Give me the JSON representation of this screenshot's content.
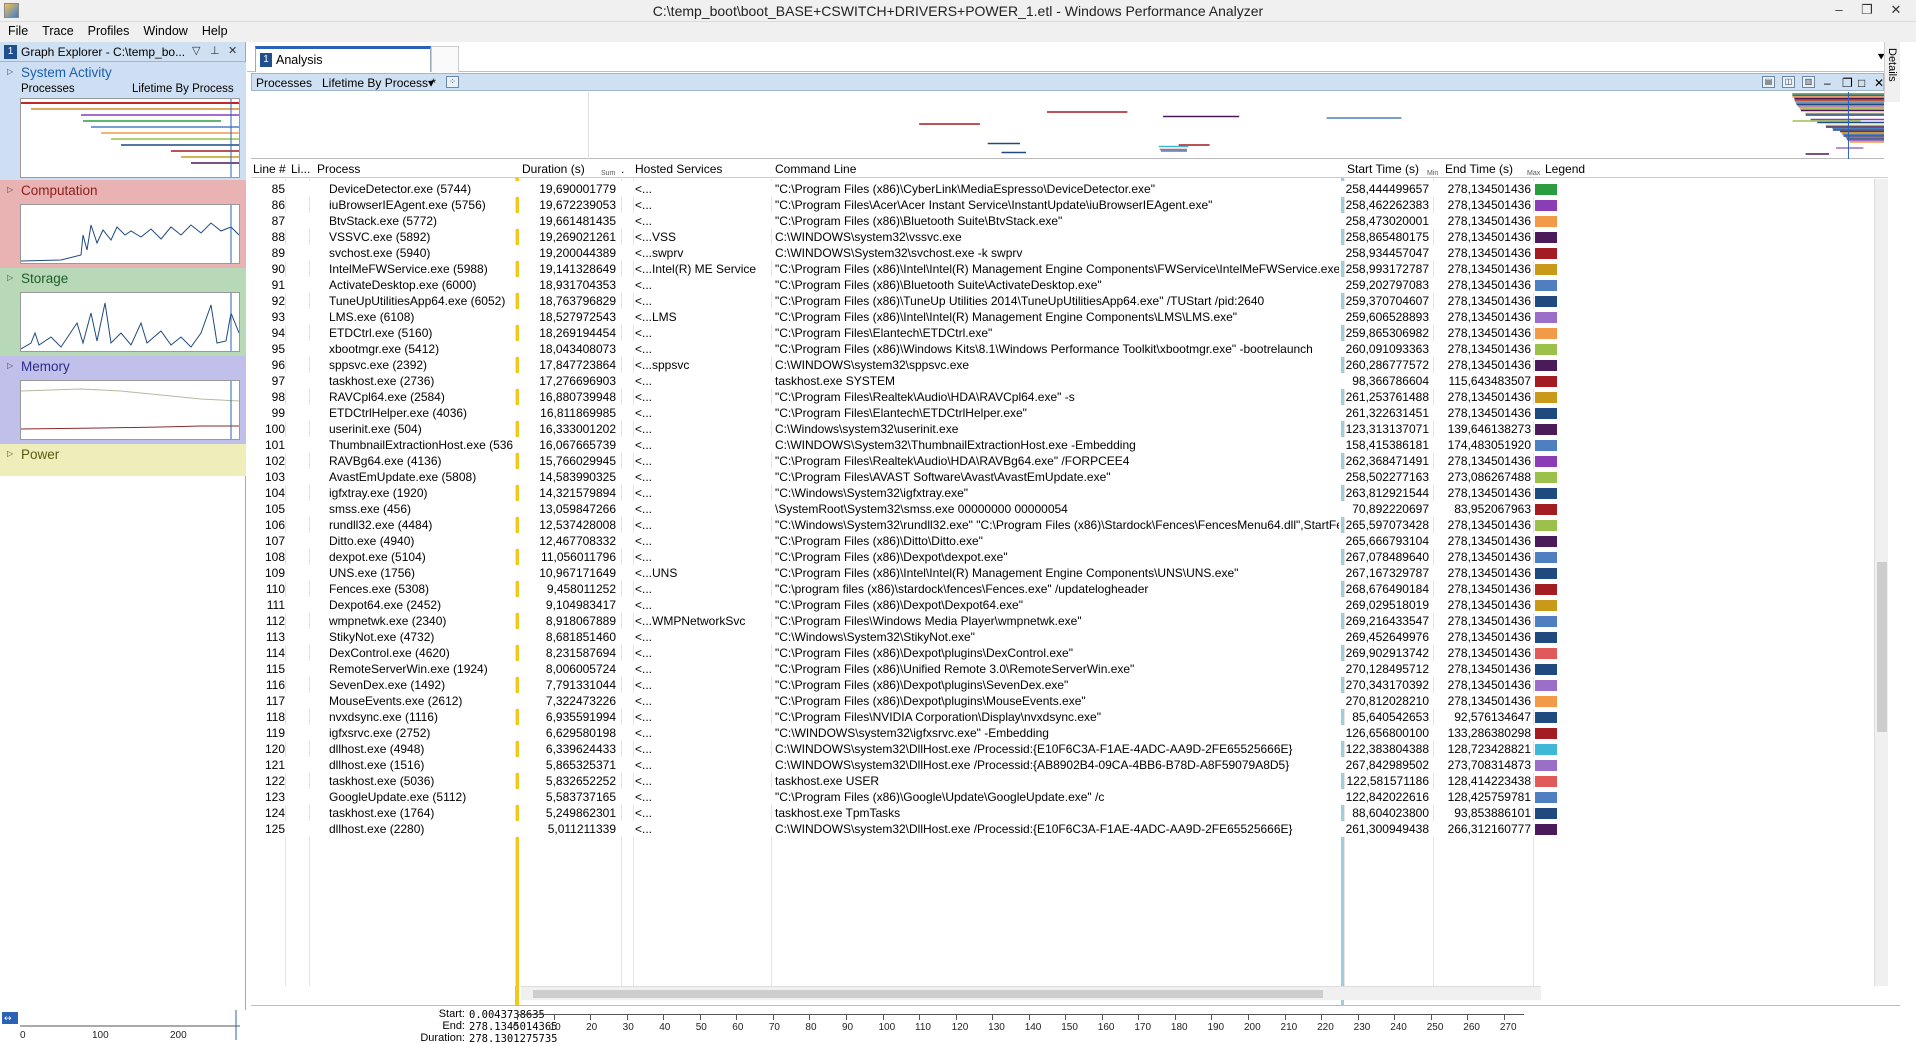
{
  "window": {
    "title": "C:\\temp_boot\\boot_BASE+CSWITCH+DRIVERS+POWER_1.etl - Windows Performance Analyzer",
    "minimize": "–",
    "restore": "❐",
    "close": "✕"
  },
  "menu": [
    "File",
    "Trace",
    "Profiles",
    "Window",
    "Help"
  ],
  "graph_explorer": {
    "number": "1",
    "title": "Graph Explorer - C:\\temp_bo...",
    "categories": [
      {
        "name": "System Activity",
        "sub_left": "Processes",
        "sub_right": "Lifetime By Process"
      },
      {
        "name": "Computation"
      },
      {
        "name": "Storage"
      },
      {
        "name": "Memory"
      },
      {
        "name": "Power"
      }
    ],
    "mini_axis": [
      "0",
      "100",
      "200"
    ]
  },
  "analysis": {
    "tab_number": "1",
    "tab_label": "Analysis",
    "details_label": "Details",
    "view_label": "Processes",
    "preset_label": "Lifetime By Process *",
    "columns": {
      "line": "Line #",
      "li": "Li...",
      "process": "Process",
      "duration": "Duration (s)",
      "duration_sub": "Sum",
      "dot": ".",
      "hosted": "Hosted Services",
      "cmd": "Command Line",
      "start": "Start Time (s)",
      "start_sub": "Min",
      "end": "End Time (s)",
      "end_sub": "Max",
      "legend": "Legend"
    }
  },
  "rows": [
    {
      "n": "85",
      "p": "DeviceDetector.exe (5744)",
      "d": "19,690001779",
      "h": "<...",
      "c": "\"C:\\Program Files (x86)\\CyberLink\\MediaEspresso\\DeviceDetector.exe\"",
      "s": "258,444499657",
      "e": "278,134501436",
      "col": "#2a9d3f"
    },
    {
      "n": "86",
      "p": "iuBrowserIEAgent.exe (5756)",
      "d": "19,672239053",
      "h": "<...",
      "c": "\"C:\\Program Files\\Acer\\Acer Instant Service\\InstantUpdate\\iuBrowserIEAgent.exe\"",
      "s": "258,462262383",
      "e": "278,134501436",
      "col": "#8a3db5"
    },
    {
      "n": "87",
      "p": "BtvStack.exe (5772)",
      "d": "19,661481435",
      "h": "<...",
      "c": "\"C:\\Program Files (x86)\\Bluetooth Suite\\BtvStack.exe\"",
      "s": "258,473020001",
      "e": "278,134501436",
      "col": "#f29a47"
    },
    {
      "n": "88",
      "p": "VSSVC.exe (5892)",
      "d": "19,269021261",
      "h": "<...VSS",
      "c": "C:\\WINDOWS\\system32\\vssvc.exe",
      "s": "258,865480175",
      "e": "278,134501436",
      "col": "#4a1a5a"
    },
    {
      "n": "89",
      "p": "svchost.exe (5940)",
      "d": "19,200044389",
      "h": "<...swprv",
      "c": "C:\\WINDOWS\\System32\\svchost.exe -k swprv",
      "s": "258,934457047",
      "e": "278,134501436",
      "col": "#a31c22"
    },
    {
      "n": "90",
      "p": "IntelMeFWService.exe (5988)",
      "d": "19,141328649",
      "h": "<...Intel(R) ME Service",
      "c": "\"C:\\Program Files (x86)\\Intel\\Intel(R) Management Engine Components\\FWService\\IntelMeFWService.exe\"",
      "s": "258,993172787",
      "e": "278,134501436",
      "col": "#c99a1a"
    },
    {
      "n": "91",
      "p": "ActivateDesktop.exe (6000)",
      "d": "18,931704353",
      "h": "<...",
      "c": "\"C:\\Program Files (x86)\\Bluetooth Suite\\ActivateDesktop.exe\"",
      "s": "259,202797083",
      "e": "278,134501436",
      "col": "#4f7fc0"
    },
    {
      "n": "92",
      "p": "TuneUpUtilitiesApp64.exe (6052)",
      "d": "18,763796829",
      "h": "<...",
      "c": "\"C:\\Program Files (x86)\\TuneUp Utilities 2014\\TuneUpUtilitiesApp64.exe\" /TUStart /pid:2640",
      "s": "259,370704607",
      "e": "278,134501436",
      "col": "#1f4a80"
    },
    {
      "n": "93",
      "p": "LMS.exe (6108)",
      "d": "18,527972543",
      "h": "<...LMS",
      "c": "\"C:\\Program Files (x86)\\Intel\\Intel(R) Management Engine Components\\LMS\\LMS.exe\"",
      "s": "259,606528893",
      "e": "278,134501436",
      "col": "#9b6fc8"
    },
    {
      "n": "94",
      "p": "ETDCtrl.exe (5160)",
      "d": "18,269194454",
      "h": "<...",
      "c": "\"C:\\Program Files\\Elantech\\ETDCtrl.exe\"",
      "s": "259,865306982",
      "e": "278,134501436",
      "col": "#f29a47"
    },
    {
      "n": "95",
      "p": "xbootmgr.exe (5412)",
      "d": "18,043408073",
      "h": "<...",
      "c": "\"C:\\Program Files (x86)\\Windows Kits\\8.1\\Windows Performance Toolkit\\xbootmgr.exe\" -bootrelaunch",
      "s": "260,091093363",
      "e": "278,134501436",
      "col": "#9bc14a"
    },
    {
      "n": "96",
      "p": "sppsvc.exe (2392)",
      "d": "17,847723864",
      "h": "<...sppsvc",
      "c": "C:\\WINDOWS\\system32\\sppsvc.exe",
      "s": "260,286777572",
      "e": "278,134501436",
      "col": "#4a1a5a"
    },
    {
      "n": "97",
      "p": "taskhost.exe (2736)",
      "d": "17,276696903",
      "h": "<...",
      "c": "taskhost.exe SYSTEM",
      "s": "98,366786604",
      "e": "115,643483507",
      "col": "#a31c22"
    },
    {
      "n": "98",
      "p": "RAVCpl64.exe (2584)",
      "d": "16,880739948",
      "h": "<...",
      "c": "\"C:\\Program Files\\Realtek\\Audio\\HDA\\RAVCpl64.exe\" -s",
      "s": "261,253761488",
      "e": "278,134501436",
      "col": "#c99a1a"
    },
    {
      "n": "99",
      "p": "ETDCtrlHelper.exe (4036)",
      "d": "16,811869985",
      "h": "<...",
      "c": "\"C:\\Program Files\\Elantech\\ETDCtrlHelper.exe\"",
      "s": "261,322631451",
      "e": "278,134501436",
      "col": "#1f4a80"
    },
    {
      "n": "100",
      "p": "userinit.exe (504)",
      "d": "16,333001202",
      "h": "<...",
      "c": "C:\\Windows\\system32\\userinit.exe",
      "s": "123,313137071",
      "e": "139,646138273",
      "col": "#4a1a5a"
    },
    {
      "n": "101",
      "p": "ThumbnailExtractionHost.exe (5368)",
      "d": "16,067665739",
      "h": "<...",
      "c": "C:\\WINDOWS\\System32\\ThumbnailExtractionHost.exe -Embedding",
      "s": "158,415386181",
      "e": "174,483051920",
      "col": "#4f7fc0"
    },
    {
      "n": "102",
      "p": "RAVBg64.exe (4136)",
      "d": "15,766029945",
      "h": "<...",
      "c": "\"C:\\Program Files\\Realtek\\Audio\\HDA\\RAVBg64.exe\" /FORPCEE4",
      "s": "262,368471491",
      "e": "278,134501436",
      "col": "#8a3db5"
    },
    {
      "n": "103",
      "p": "AvastEmUpdate.exe (5808)",
      "d": "14,583990325",
      "h": "<...",
      "c": "\"C:\\Program Files\\AVAST Software\\Avast\\AvastEmUpdate.exe\"",
      "s": "258,502277163",
      "e": "273,086267488",
      "col": "#9bc14a"
    },
    {
      "n": "104",
      "p": "igfxtray.exe (1920)",
      "d": "14,321579894",
      "h": "<...",
      "c": "\"C:\\Windows\\System32\\igfxtray.exe\"",
      "s": "263,812921544",
      "e": "278,134501436",
      "col": "#1f4a80"
    },
    {
      "n": "105",
      "p": "smss.exe (456)",
      "d": "13,059847266",
      "h": "<...",
      "c": "\\SystemRoot\\System32\\smss.exe 00000000 00000054",
      "s": "70,892220697",
      "e": "83,952067963",
      "col": "#a31c22"
    },
    {
      "n": "106",
      "p": "rundll32.exe (4484)",
      "d": "12,537428008",
      "h": "<...",
      "c": "\"C:\\Windows\\System32\\rundll32.exe\" \"C:\\Program Files (x86)\\Stardock\\Fences\\FencesMenu64.dll\",StartFences",
      "s": "265,597073428",
      "e": "278,134501436",
      "col": "#9bc14a"
    },
    {
      "n": "107",
      "p": "Ditto.exe (4940)",
      "d": "12,467708332",
      "h": "<...",
      "c": "\"C:\\Program Files (x86)\\Ditto\\Ditto.exe\"",
      "s": "265,666793104",
      "e": "278,134501436",
      "col": "#4a1a5a"
    },
    {
      "n": "108",
      "p": "dexpot.exe (5104)",
      "d": "11,056011796",
      "h": "<...",
      "c": "\"C:\\Program Files (x86)\\Dexpot\\dexpot.exe\"",
      "s": "267,078489640",
      "e": "278,134501436",
      "col": "#4f7fc0"
    },
    {
      "n": "109",
      "p": "UNS.exe (1756)",
      "d": "10,967171649",
      "h": "<...UNS",
      "c": "\"C:\\Program Files (x86)\\Intel\\Intel(R) Management Engine Components\\UNS\\UNS.exe\"",
      "s": "267,167329787",
      "e": "278,134501436",
      "col": "#1f4a80"
    },
    {
      "n": "110",
      "p": "Fences.exe (5308)",
      "d": "9,458011252",
      "h": "<...",
      "c": "\"C:\\program files (x86)\\stardock\\fences\\Fences.exe\" /updatelogheader",
      "s": "268,676490184",
      "e": "278,134501436",
      "col": "#a31c22"
    },
    {
      "n": "111",
      "p": "Dexpot64.exe (2452)",
      "d": "9,104983417",
      "h": "<...",
      "c": "\"C:\\Program Files (x86)\\Dexpot\\Dexpot64.exe\"",
      "s": "269,029518019",
      "e": "278,134501436",
      "col": "#c99a1a"
    },
    {
      "n": "112",
      "p": "wmpnetwk.exe (2340)",
      "d": "8,918067889",
      "h": "<...WMPNetworkSvc",
      "c": "\"C:\\Program Files\\Windows Media Player\\wmpnetwk.exe\"",
      "s": "269,216433547",
      "e": "278,134501436",
      "col": "#4f7fc0"
    },
    {
      "n": "113",
      "p": "StikyNot.exe (4732)",
      "d": "8,681851460",
      "h": "<...",
      "c": "\"C:\\Windows\\System32\\StikyNot.exe\"",
      "s": "269,452649976",
      "e": "278,134501436",
      "col": "#1f4a80"
    },
    {
      "n": "114",
      "p": "DexControl.exe (4620)",
      "d": "8,231587694",
      "h": "<...",
      "c": "\"C:\\Program Files (x86)\\Dexpot\\plugins\\DexControl.exe\"",
      "s": "269,902913742",
      "e": "278,134501436",
      "col": "#e05a5a"
    },
    {
      "n": "115",
      "p": "RemoteServerWin.exe (1924)",
      "d": "8,006005724",
      "h": "<...",
      "c": "\"C:\\Program Files (x86)\\Unified Remote 3.0\\RemoteServerWin.exe\"",
      "s": "270,128495712",
      "e": "278,134501436",
      "col": "#1f4a80"
    },
    {
      "n": "116",
      "p": "SevenDex.exe (1492)",
      "d": "7,791331044",
      "h": "<...",
      "c": "\"C:\\Program Files (x86)\\Dexpot\\plugins\\SevenDex.exe\"",
      "s": "270,343170392",
      "e": "278,134501436",
      "col": "#9b6fc8"
    },
    {
      "n": "117",
      "p": "MouseEvents.exe (2612)",
      "d": "7,322473226",
      "h": "<...",
      "c": "\"C:\\Program Files (x86)\\Dexpot\\plugins\\MouseEvents.exe\"",
      "s": "270,812028210",
      "e": "278,134501436",
      "col": "#f29a47"
    },
    {
      "n": "118",
      "p": "nvxdsync.exe (1116)",
      "d": "6,935591994",
      "h": "<...",
      "c": "\"C:\\Program Files\\NVIDIA Corporation\\Display\\nvxdsync.exe\"",
      "s": "85,640542653",
      "e": "92,576134647",
      "col": "#1f4a80"
    },
    {
      "n": "119",
      "p": "igfxsrvc.exe (2752)",
      "d": "6,629580198",
      "h": "<...",
      "c": "\"C:\\WINDOWS\\system32\\igfxsrvc.exe\" -Embedding",
      "s": "126,656800100",
      "e": "133,286380298",
      "col": "#a31c22"
    },
    {
      "n": "120",
      "p": "dllhost.exe (4948)",
      "d": "6,339624433",
      "h": "<...",
      "c": "C:\\WINDOWS\\system32\\DllHost.exe /Processid:{E10F6C3A-F1AE-4ADC-AA9D-2FE65525666E}",
      "s": "122,383804388",
      "e": "128,723428821",
      "col": "#3fb8d8"
    },
    {
      "n": "121",
      "p": "dllhost.exe (1516)",
      "d": "5,865325371",
      "h": "<...",
      "c": "C:\\WINDOWS\\system32\\DllHost.exe /Processid:{AB8902B4-09CA-4BB6-B78D-A8F59079A8D5}",
      "s": "267,842989502",
      "e": "273,708314873",
      "col": "#9b6fc8"
    },
    {
      "n": "122",
      "p": "taskhost.exe (5036)",
      "d": "5,832652252",
      "h": "<...",
      "c": "taskhost.exe USER",
      "s": "122,581571186",
      "e": "128,414223438",
      "col": "#e05a5a"
    },
    {
      "n": "123",
      "p": "GoogleUpdate.exe (5112)",
      "d": "5,583737165",
      "h": "<...",
      "c": "\"C:\\Program Files (x86)\\Google\\Update\\GoogleUpdate.exe\" /c",
      "s": "122,842022616",
      "e": "128,425759781",
      "col": "#4f7fc0"
    },
    {
      "n": "124",
      "p": "taskhost.exe (1764)",
      "d": "5,249862301",
      "h": "<...",
      "c": "taskhost.exe TpmTasks",
      "s": "88,604023800",
      "e": "93,853886101",
      "col": "#1f4a80"
    },
    {
      "n": "125",
      "p": "dllhost.exe (2280)",
      "d": "5,011211339",
      "h": "<...",
      "c": "C:\\WINDOWS\\system32\\DllHost.exe /Processid:{E10F6C3A-F1AE-4ADC-AA9D-2FE65525666E}",
      "s": "261,300949438",
      "e": "266,312160777",
      "col": "#4a1a5a"
    }
  ],
  "timeline": {
    "start_label": "Start:",
    "start_value": "0.0043738635",
    "end_label": "End:",
    "end_value": "278.1345014365",
    "duration_label": "Duration:",
    "duration_value": "278.1301275735",
    "ticks": [
      "0",
      "10",
      "20",
      "30",
      "40",
      "50",
      "60",
      "70",
      "80",
      "90",
      "100",
      "110",
      "120",
      "130",
      "140",
      "150",
      "160",
      "170",
      "180",
      "190",
      "200",
      "210",
      "220",
      "230",
      "240",
      "250",
      "260",
      "270"
    ]
  }
}
